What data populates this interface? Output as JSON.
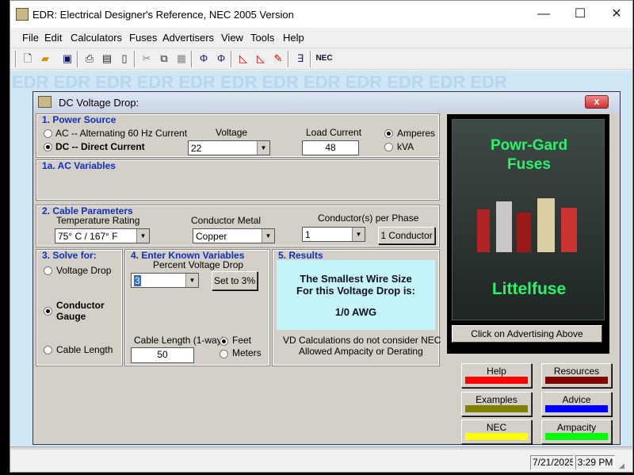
{
  "window": {
    "title": "EDR: Electrical Designer's Reference,  NEC 2005 Version",
    "minimize": "—",
    "maximize": "☐",
    "close": "✕"
  },
  "menu": [
    "File",
    "Edit",
    "Calculators",
    "Fuses",
    "Advertisers",
    "View",
    "Tools",
    "Help"
  ],
  "toolbar": {
    "nec_label": "NEC"
  },
  "watermark": "EDR",
  "dialog": {
    "title": "DC Voltage Drop:",
    "close": "x",
    "power_source": {
      "title": "1. Power Source",
      "ac_label": "AC -- Alternating 60 Hz Current",
      "dc_label": "DC -- Direct Current",
      "voltage_label": "Voltage",
      "voltage_value": "22",
      "load_current_label": "Load Current",
      "load_current_value": "48",
      "amperes_label": "Amperes",
      "kva_label": "kVA"
    },
    "ac_variables": {
      "title": "1a.  AC Variables"
    },
    "cable": {
      "title": "2. Cable Parameters",
      "temp_label": "Temperature Rating",
      "temp_value": "75° C  /  167° F",
      "metal_label": "Conductor Metal",
      "metal_value": "Copper",
      "per_phase_label": "Conductor(s) per Phase",
      "per_phase_value": "1",
      "per_phase_button": "1 Conductor"
    },
    "solve": {
      "title": "3. Solve for:",
      "voltage_drop": "Voltage Drop",
      "conductor_gauge_1": "Conductor",
      "conductor_gauge_2": "Gauge",
      "cable_length": "Cable Length"
    },
    "known": {
      "title": "4. Enter Known Variables",
      "percent_label": "Percent Voltage Drop",
      "percent_value": "3",
      "set_button": "Set to 3%",
      "length_label": "Cable Length (1-way)",
      "length_value": "50",
      "feet_label": "Feet",
      "meters_label": "Meters"
    },
    "results": {
      "title": "5. Results",
      "line1": "The Smallest Wire Size",
      "line2": "For this Voltage Drop is:",
      "value": "1/0 AWG",
      "note1": "VD Calculations do not consider NEC",
      "note2": "Allowed Ampacity or Derating"
    },
    "ad": {
      "brand1": "Powr-Gard",
      "brand2": "Fuses",
      "company": "Littelfuse",
      "button": "Click on Advertising Above"
    },
    "side_buttons": [
      {
        "label": "Help",
        "color": "#ff0000"
      },
      {
        "label": "Resources",
        "color": "#800000"
      },
      {
        "label": "Examples",
        "color": "#808000"
      },
      {
        "label": "Advice",
        "color": "#0000ff"
      },
      {
        "label": "NEC",
        "color": "#ffff00"
      },
      {
        "label": "Ampacity",
        "color": "#00ff00"
      }
    ]
  },
  "status": {
    "date": "7/21/2025",
    "time": "3:29 PM"
  }
}
